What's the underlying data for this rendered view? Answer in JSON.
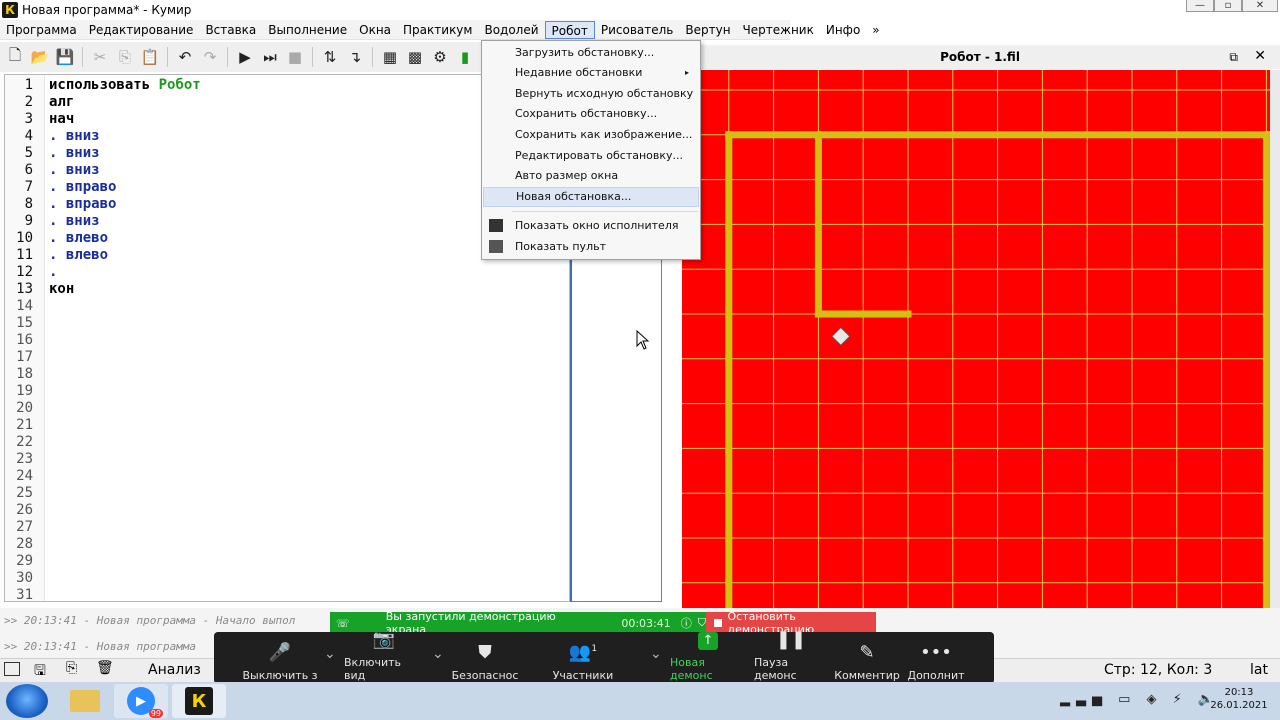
{
  "window": {
    "title": "Новая программа* - Кумир",
    "icon_letter": "К"
  },
  "menubar": [
    "Программа",
    "Редактирование",
    "Вставка",
    "Выполнение",
    "Окна",
    "Практикум",
    "Водолей",
    "Робот",
    "Рисователь",
    "Вертун",
    "Чертежник",
    "Инфо",
    "»"
  ],
  "active_menu": "Робот",
  "editor": {
    "line_numbers": [
      "1",
      "2",
      "3",
      "4",
      "5",
      "6",
      "7",
      "8",
      "9",
      "10",
      "11",
      "12",
      "13",
      "14",
      "15",
      "16",
      "17",
      "18",
      "19",
      "20",
      "21",
      "22",
      "23",
      "24",
      "25",
      "26",
      "27",
      "28",
      "29",
      "30",
      "31"
    ],
    "line1_kw": "использовать",
    "line1_exe": "Робот",
    "lines": [
      "алг",
      "нач",
      ". вниз",
      ". вниз",
      ". вниз",
      ". вправо",
      ". вправо",
      ". вниз",
      ". влево",
      ". влево",
      ".",
      "кон"
    ]
  },
  "dropdown": {
    "items": [
      "Загрузить обстановку...",
      "Недавние обстановки",
      "Вернуть исходную обстановку",
      "Сохранить обстановку...",
      "Сохранить как изображение...",
      "Редактировать обстановку...",
      "Авто размер окна",
      "Новая обстановка...",
      "Показать окно исполнителя",
      "Показать пульт"
    ],
    "submenu_arrow": "▸"
  },
  "robot": {
    "title": "Робот - 1.fil",
    "field_color": "#ff0000",
    "grid_color": "#e8c840",
    "wall_color": "#d4c010",
    "cols": 14,
    "rows": 12,
    "robot_cell": [
      3,
      6
    ],
    "walls": [
      [
        1,
        1,
        13,
        1
      ],
      [
        1,
        1,
        1,
        12
      ],
      [
        13,
        1,
        13,
        12
      ],
      [
        1,
        12,
        13,
        12
      ],
      [
        3,
        1,
        3,
        5
      ],
      [
        3,
        5,
        5,
        5
      ]
    ]
  },
  "log": [
    ">> 20:13:41 - Новая программа - Начало выпол",
    ">> 20:13:41 - Новая программа"
  ],
  "status": {
    "analysis": "Анализ",
    "position": "Стр: 12, Кол: 3",
    "lang": "lat"
  },
  "zoom": {
    "share_text": "Вы запустили демонстрацию экрана",
    "share_time": "00:03:41",
    "stop_text": "Остановить демонстрацию",
    "buttons": [
      {
        "label": "Выключить з",
        "icon": "microphone-icon"
      },
      {
        "label": "Включить вид",
        "icon": "video-off-icon"
      },
      {
        "label": "Безопаснос",
        "icon": "shield-icon"
      },
      {
        "label": "Участники",
        "icon": "participants-icon",
        "badge": "1"
      },
      {
        "label": "Новая демонс",
        "icon": "share-screen-icon"
      },
      {
        "label": "Пауза демонс",
        "icon": "pause-icon"
      },
      {
        "label": "Комментир",
        "icon": "pencil-icon"
      },
      {
        "label": "Дополнит",
        "icon": "more-icon"
      }
    ],
    "accent": "#17a328"
  },
  "taskbar": {
    "clock_time": "20:13",
    "clock_date": "26.01.2021",
    "zoom_badge": "99"
  }
}
